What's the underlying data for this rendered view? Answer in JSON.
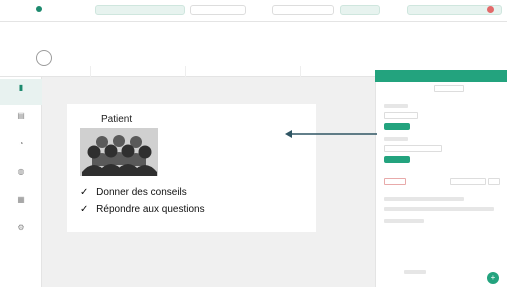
{
  "slide": {
    "title": "Patient",
    "bullets": [
      {
        "check": "✓",
        "text": "Donner des conseils"
      },
      {
        "check": "✓",
        "text": "Répondre aux questions"
      }
    ]
  },
  "colors": {
    "accent": "#23a37e",
    "alert": "#e26a6a",
    "arrow": "#2f5563"
  },
  "icons": {
    "arrow": "arrow-left-icon",
    "crowd": "patient-group-icon",
    "fab": "plus-icon"
  }
}
